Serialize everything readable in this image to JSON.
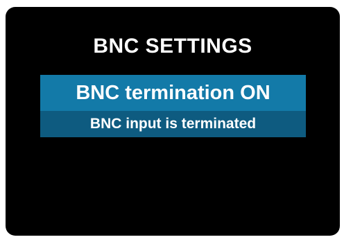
{
  "screen": {
    "title": "BNC SETTINGS"
  },
  "option": {
    "label": "BNC termination ON",
    "description": "BNC input is terminated"
  },
  "colors": {
    "background": "#000000",
    "selected": "#137aa8",
    "selected_sub": "#0e5b80",
    "text": "#ffffff"
  }
}
